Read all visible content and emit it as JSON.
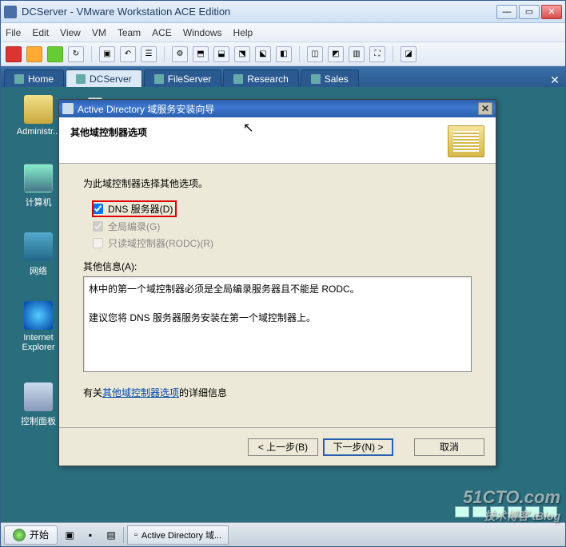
{
  "vmware": {
    "title": "DCServer - VMware Workstation ACE Edition",
    "menus": [
      "File",
      "Edit",
      "View",
      "VM",
      "Team",
      "ACE",
      "Windows",
      "Help"
    ],
    "tabs": [
      {
        "label": "Home",
        "icon": "home-icon"
      },
      {
        "label": "DCServer",
        "icon": "vm-icon",
        "active": true
      },
      {
        "label": "FileServer",
        "icon": "vm-icon"
      },
      {
        "label": "Research",
        "icon": "vm-icon"
      },
      {
        "label": "Sales",
        "icon": "vm-icon"
      }
    ],
    "win_controls": {
      "min": "—",
      "max": "▭",
      "close": "✕"
    }
  },
  "desktop": {
    "icons": [
      {
        "name": "admin",
        "label": "Administr..."
      },
      {
        "name": "computer",
        "label": "计算机"
      },
      {
        "name": "network",
        "label": "网络"
      },
      {
        "name": "ie",
        "label": "Internet Explorer"
      },
      {
        "name": "panel",
        "label": "控制面板"
      }
    ],
    "start_label": "开始",
    "task_button": "Active Directory 域..."
  },
  "wizard": {
    "title": "Active Directory 域服务安装向导",
    "heading": "其他域控制器选项",
    "intro": "为此域控制器选择其他选项。",
    "options": [
      {
        "key": "dns",
        "label": "DNS 服务器(D)",
        "checked": true,
        "enabled": true,
        "highlight": true
      },
      {
        "key": "gc",
        "label": "全局编录(G)",
        "checked": true,
        "enabled": false
      },
      {
        "key": "rodc",
        "label": "只读域控制器(RODC)(R)",
        "checked": false,
        "enabled": false
      }
    ],
    "info_label": "其他信息(A):",
    "info_text": "林中的第一个域控制器必须是全局编录服务器且不能是 RODC。\n\n建议您将 DNS 服务器服务安装在第一个域控制器上。",
    "link_prefix": "有关",
    "link_text": "其他域控制器选项",
    "link_suffix": "的详细信息",
    "buttons": {
      "back": "< 上一步(B)",
      "next": "下一步(N) >",
      "cancel": "取消"
    },
    "close_x": "✕"
  },
  "watermark": {
    "main": "51CTO.com",
    "sub": "技术博客  tBlog"
  }
}
